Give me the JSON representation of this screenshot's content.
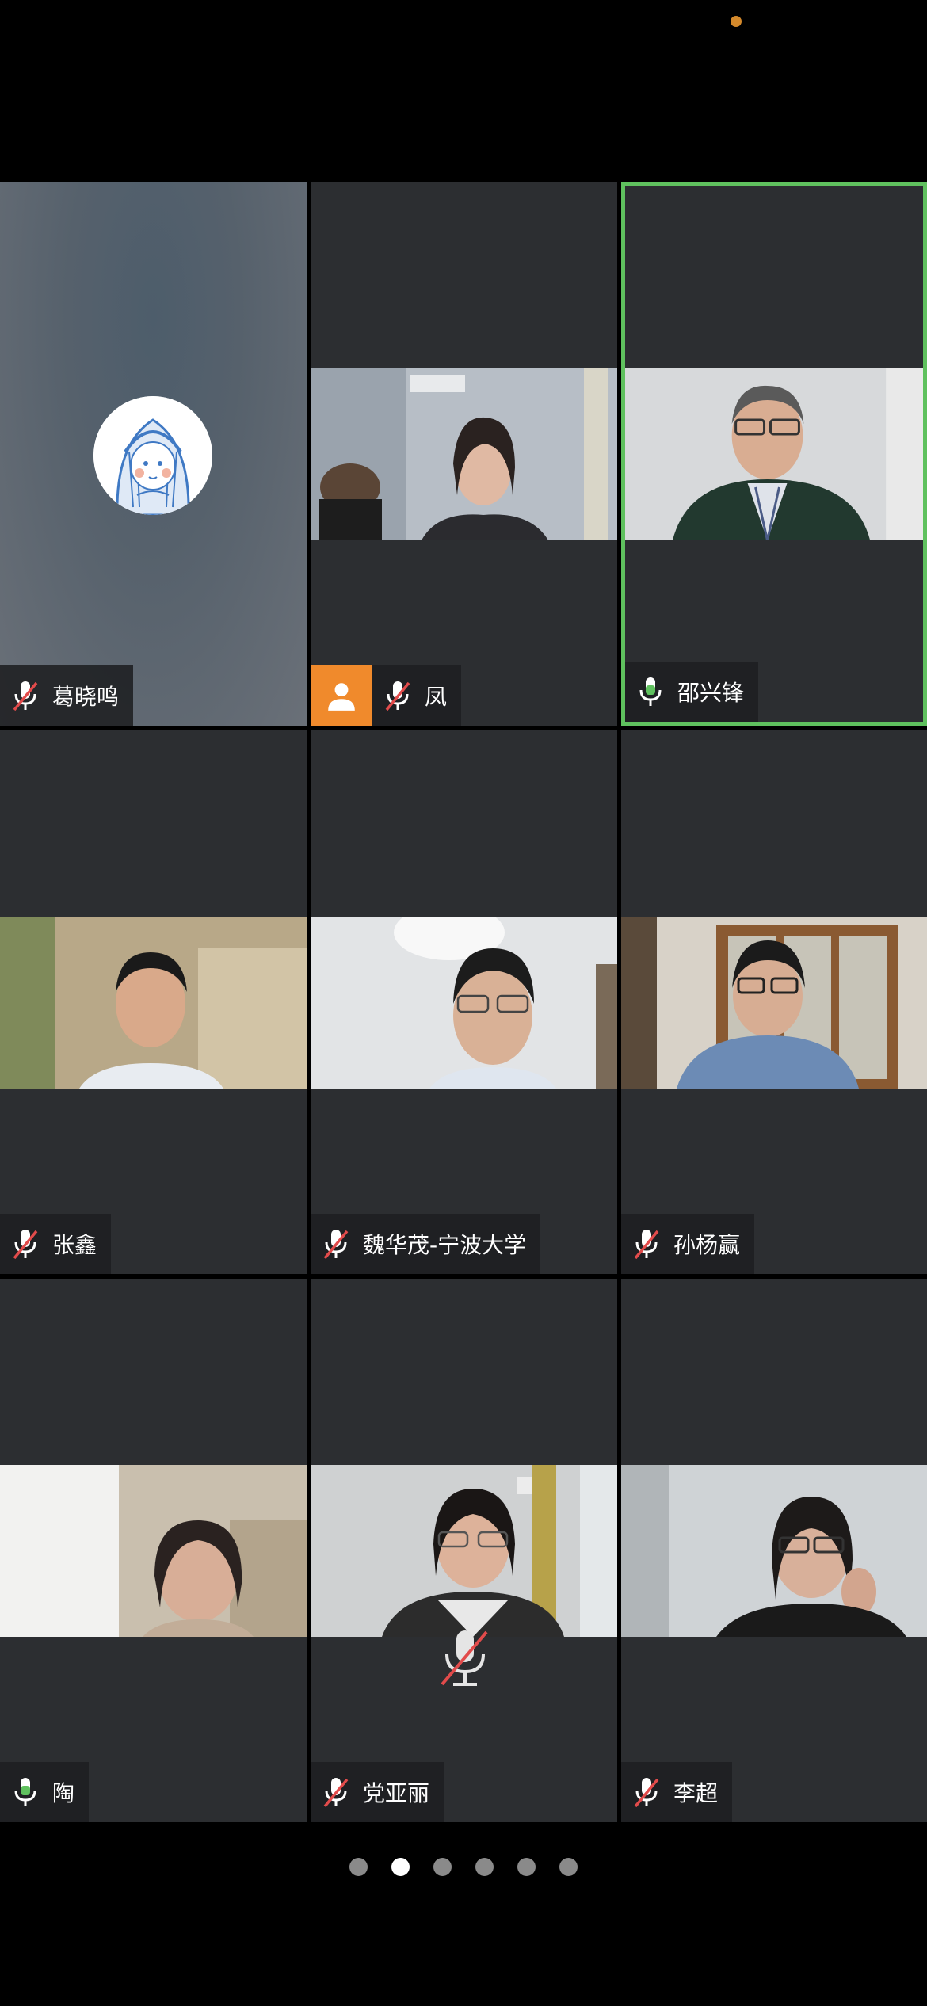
{
  "participants": [
    {
      "name": "葛晓鸣",
      "mic": "muted",
      "view": "avatar"
    },
    {
      "name": "凤",
      "mic": "muted",
      "view": "video",
      "badge": "person-icon"
    },
    {
      "name": "邵兴锋",
      "mic": "active",
      "view": "video",
      "active_speaker": true
    },
    {
      "name": "张鑫",
      "mic": "muted",
      "view": "video"
    },
    {
      "name": "魏华茂-宁波大学",
      "mic": "muted",
      "view": "video"
    },
    {
      "name": "孙杨赢",
      "mic": "muted",
      "view": "video"
    },
    {
      "name": "陶",
      "mic": "active",
      "view": "video"
    },
    {
      "name": "党亚丽",
      "mic": "muted",
      "view": "video",
      "overlay": "muted-mic-icon"
    },
    {
      "name": "李超",
      "mic": "muted",
      "view": "video"
    }
  ],
  "pager": {
    "count": 6,
    "active_index": 1
  },
  "colors": {
    "active_speaker_border": "#5fc15e",
    "tile_bg": "#2c2e31",
    "badge_orange": "#f08a2c",
    "status_dot": "#d4892b"
  }
}
